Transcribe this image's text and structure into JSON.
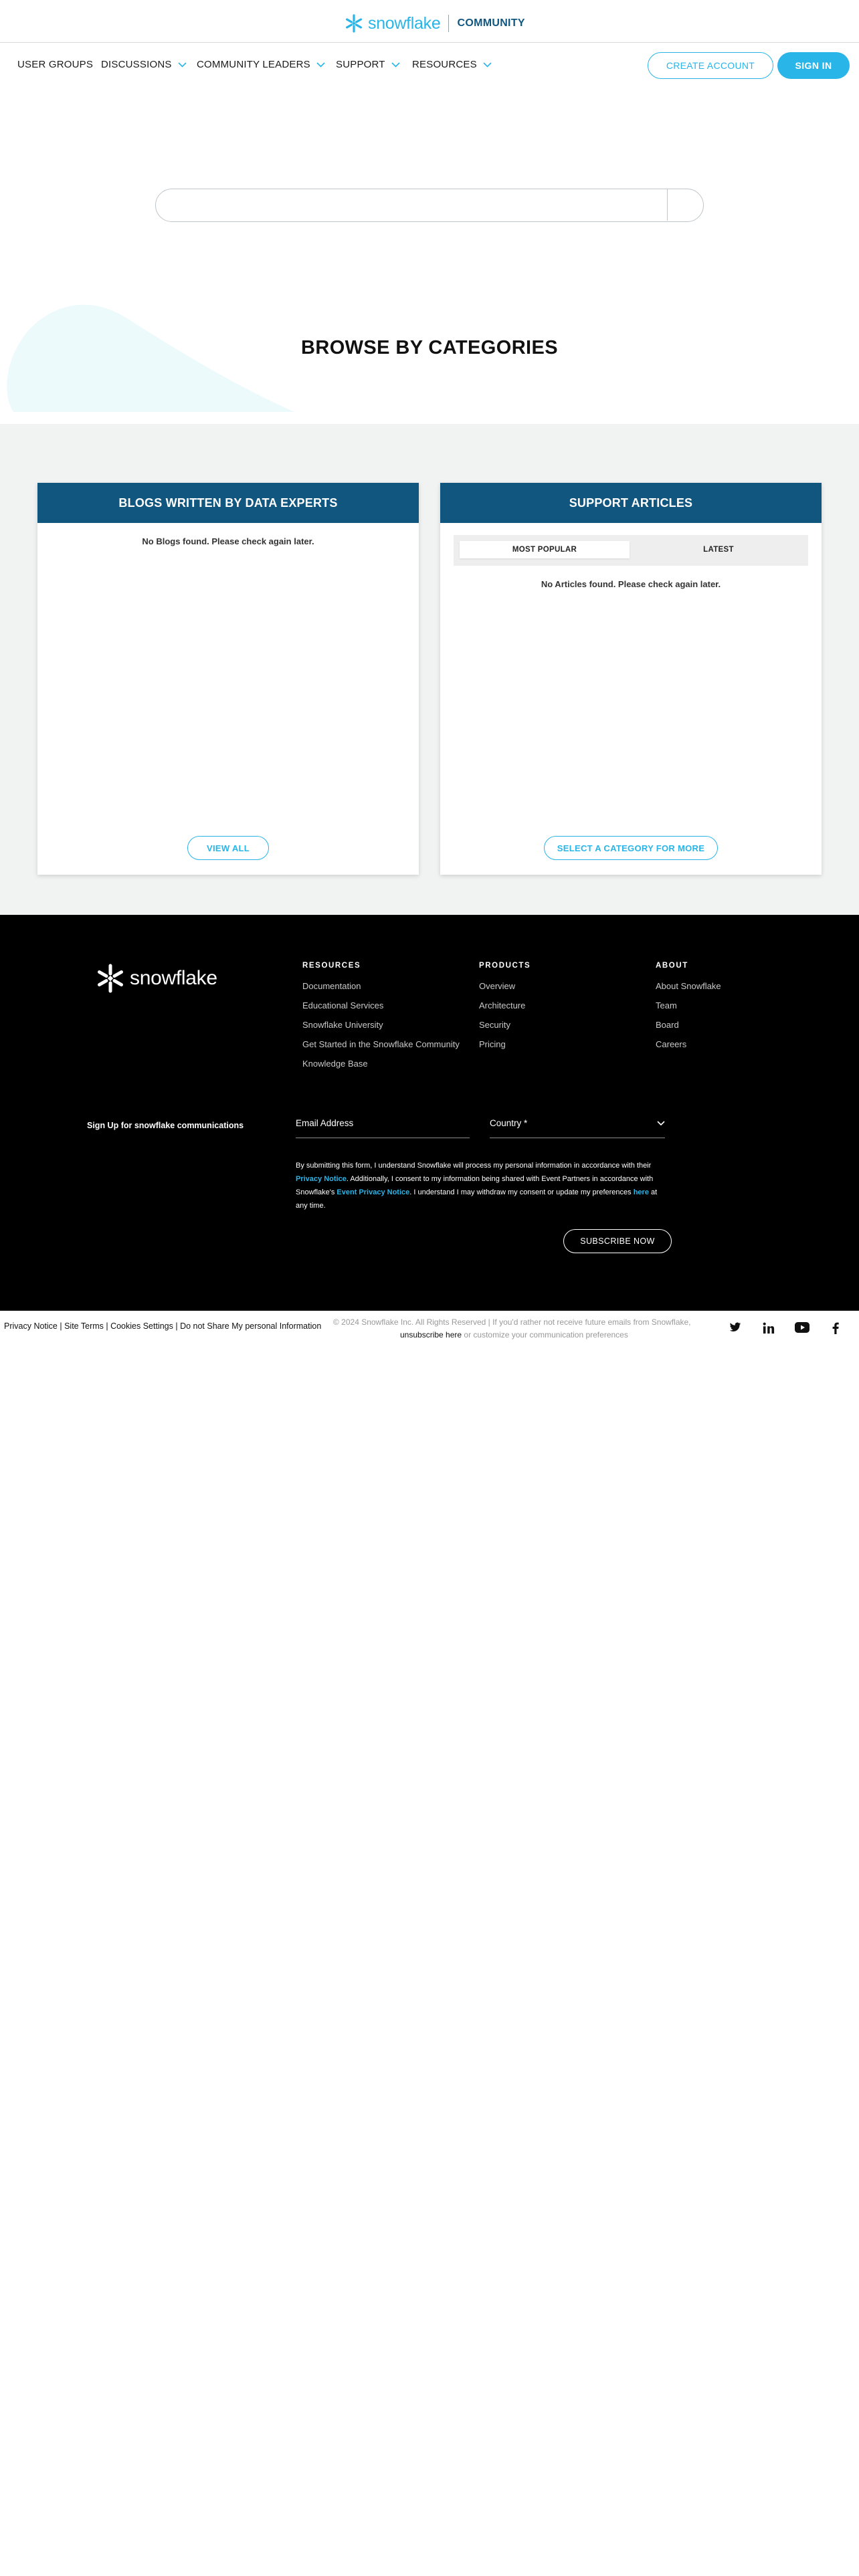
{
  "brand": {
    "logo_text": "snowflake",
    "community": "COMMUNITY"
  },
  "nav": {
    "items": [
      {
        "label": "USER GROUPS",
        "dropdown": false
      },
      {
        "label": "DISCUSSIONS",
        "dropdown": true
      },
      {
        "label": "COMMUNITY LEADERS",
        "dropdown": true
      },
      {
        "label": "SUPPORT",
        "dropdown": true
      },
      {
        "label": "RESOURCES",
        "dropdown": true
      }
    ],
    "create_account": "CREATE ACCOUNT",
    "sign_in": "SIGN IN"
  },
  "search": {
    "value": "",
    "placeholder": ""
  },
  "browse_title": "BROWSE BY CATEGORIES",
  "blogs": {
    "title": "BLOGS WRITTEN BY DATA EXPERTS",
    "empty": "No Blogs found. Please check again later.",
    "button": "VIEW ALL"
  },
  "support": {
    "title": "SUPPORT ARTICLES",
    "tabs": [
      {
        "label": "MOST POPULAR",
        "active": true
      },
      {
        "label": "LATEST",
        "active": false
      }
    ],
    "empty": "No Articles found. Please check again later.",
    "button": "SELECT A CATEGORY FOR MORE"
  },
  "footer": {
    "logo_text": "snowflake",
    "columns": [
      {
        "heading": "RESOURCES",
        "links": [
          "Documentation",
          "Educational Services",
          "Snowflake University",
          "Get Started in the Snowflake Community",
          "Knowledge Base"
        ]
      },
      {
        "heading": "PRODUCTS",
        "links": [
          "Overview",
          "Architecture",
          "Security",
          "Pricing"
        ]
      },
      {
        "heading": "ABOUT",
        "links": [
          "About Snowflake",
          "Team",
          "Board",
          "Careers"
        ]
      }
    ],
    "signup_label": "Sign Up for snowflake communications",
    "email_label": "Email Address",
    "country_label": "Country *",
    "consent": {
      "p1": "By submitting this form, I understand Snowflake will process my personal information in accordance with their ",
      "l1": "Privacy Notice",
      "p2": ". Additionally, I consent to my information being shared with Event Partners in accordance with Snowflake's ",
      "l2": "Event Privacy Notice",
      "p3": ". I understand I may withdraw my consent or update my preferences ",
      "l3": "here",
      "p4": " at any time."
    },
    "subscribe": "SUBSCRIBE NOW"
  },
  "bottom": {
    "legal": "Privacy Notice | Site Terms | Cookies Settings | Do not Share My personal Information",
    "copyright": "© 2024 Snowflake Inc. All Rights Reserved | If you'd rather not receive future emails from Snowflake,",
    "unsubscribe": "unsubscribe here",
    "customize": " or customize your communication preferences"
  },
  "social": [
    "twitter-icon",
    "linkedin-icon",
    "youtube-icon",
    "facebook-icon"
  ],
  "colors": {
    "accent": "#29b5e8",
    "header_blue": "#11567f",
    "panel_gray": "#f1f3f2",
    "footer_bg": "#000000"
  }
}
